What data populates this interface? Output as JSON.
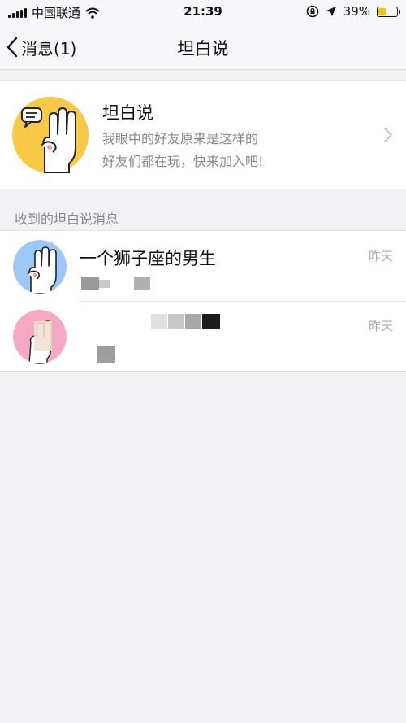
{
  "status_bar": {
    "carrier": "中国联通",
    "time": "21:39",
    "battery_percent": "39%",
    "battery_level": 0.39
  },
  "nav": {
    "back_label": "消息(1)",
    "title": "坦白说"
  },
  "card": {
    "title": "坦白说",
    "subtitle_line1": "我眼中的好友原来是这样的",
    "subtitle_line2": "好友们都在玩，快来加入吧!"
  },
  "section": {
    "header": "收到的坦白说消息"
  },
  "messages": [
    {
      "name": "一个狮子座的男生",
      "time": "昨天"
    },
    {
      "name": "",
      "time": "昨天"
    }
  ],
  "colors": {
    "accent_yellow": "#f7c946",
    "avatar_blue": "#9cc8f7",
    "avatar_pink": "#f6a8c4"
  }
}
